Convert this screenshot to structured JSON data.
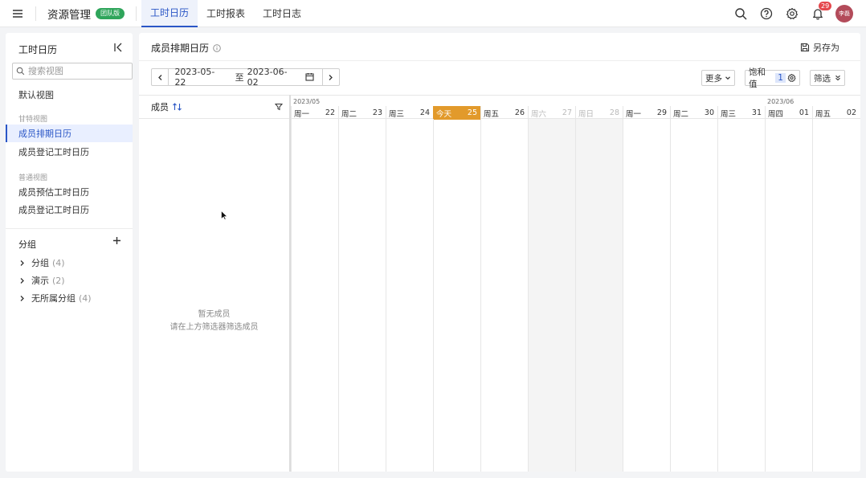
{
  "topbar": {
    "app_title": "资源管理",
    "team_badge": "团队版",
    "tabs": [
      {
        "label": "工时日历",
        "active": true
      },
      {
        "label": "工时报表",
        "active": false
      },
      {
        "label": "工时日志",
        "active": false
      }
    ],
    "notification_count": "29",
    "user_avatar": "李磊",
    "icons": [
      "menu-icon",
      "search-icon",
      "help-icon",
      "settings-icon",
      "bell-icon"
    ]
  },
  "sidebar": {
    "title": "工时日历",
    "search_placeholder": "搜索视图",
    "default_view": "默认视图",
    "gantt_category": "甘特视图",
    "gantt_items": [
      "成员排期日历",
      "成员登记工时日历"
    ],
    "normal_category": "普通视图",
    "normal_items": [
      "成员预估工时日历",
      "成员登记工时日历"
    ],
    "group_header": "分组",
    "groups": [
      {
        "name": "分组",
        "count": "(4)"
      },
      {
        "name": "演示",
        "count": "(2)"
      },
      {
        "name": "无所属分组",
        "count": "(4)"
      }
    ],
    "active_item": "成员排期日历"
  },
  "main": {
    "title": "成员排期日历",
    "save_as": "另存为",
    "date_start": "2023-05-22",
    "date_to": "至",
    "date_end": "2023-06-02",
    "more_label": "更多",
    "saturation_label": "饱和值",
    "saturation_value": "1",
    "filter_label": "筛选",
    "members_header": "成员",
    "empty_title": "暂无成员",
    "empty_hint": "请在上方筛选器筛选成员",
    "months": [
      {
        "label": "2023/05",
        "first_day_index": 0
      },
      {
        "label": "2023/06",
        "first_day_index": 10
      }
    ],
    "days": [
      {
        "weekday": "周一",
        "date": "22",
        "weekend": false,
        "today": false
      },
      {
        "weekday": "周二",
        "date": "23",
        "weekend": false,
        "today": false
      },
      {
        "weekday": "周三",
        "date": "24",
        "weekend": false,
        "today": false
      },
      {
        "weekday": "今天",
        "date": "25",
        "weekend": false,
        "today": true
      },
      {
        "weekday": "周五",
        "date": "26",
        "weekend": false,
        "today": false
      },
      {
        "weekday": "周六",
        "date": "27",
        "weekend": true,
        "today": false
      },
      {
        "weekday": "周日",
        "date": "28",
        "weekend": true,
        "today": false
      },
      {
        "weekday": "周一",
        "date": "29",
        "weekend": false,
        "today": false
      },
      {
        "weekday": "周二",
        "date": "30",
        "weekend": false,
        "today": false
      },
      {
        "weekday": "周三",
        "date": "31",
        "weekend": false,
        "today": false
      },
      {
        "weekday": "周四",
        "date": "01",
        "weekend": false,
        "today": false
      },
      {
        "weekday": "周五",
        "date": "02",
        "weekend": false,
        "today": false
      }
    ]
  },
  "colors": {
    "accent": "#2a56c6",
    "today": "#e29a2b",
    "team_badge": "#2fa55b",
    "notification": "#e5484d"
  }
}
